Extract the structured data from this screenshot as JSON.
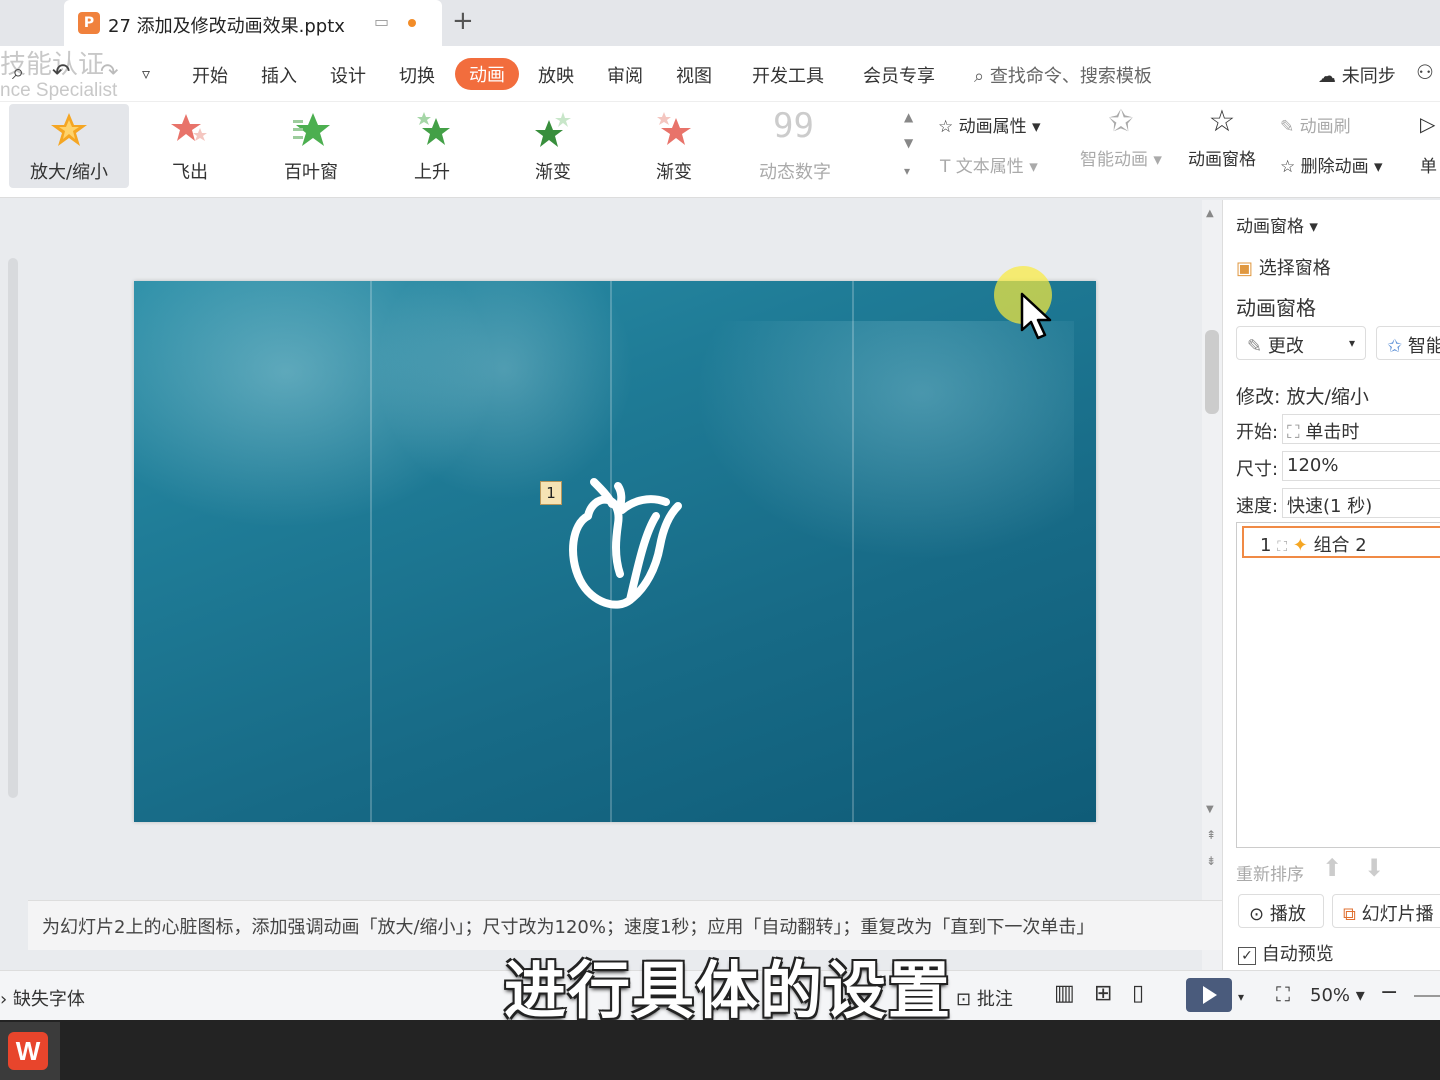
{
  "titlebar": {
    "file_name": "27 添加及修改动画效果.pptx",
    "new_tab_symbol": "+"
  },
  "watermark": {
    "line1": "技能认证",
    "line2": "nce Specialist"
  },
  "menu": {
    "items": [
      "开始",
      "插入",
      "设计",
      "切换",
      "动画",
      "放映",
      "审阅",
      "视图",
      "开发工具",
      "会员专享"
    ],
    "active": "动画",
    "search_placeholder": "查找命令、搜索模板",
    "sync_status": "未同步"
  },
  "ribbon": {
    "effects": [
      {
        "label": "放大/缩小",
        "icon": "zoom-star-icon",
        "selected": true
      },
      {
        "label": "飞出",
        "icon": "fly-out-star-icon"
      },
      {
        "label": "百叶窗",
        "icon": "blinds-star-icon"
      },
      {
        "label": "上升",
        "icon": "rise-star-icon"
      },
      {
        "label": "渐变",
        "icon": "fade-star-icon"
      },
      {
        "label": "渐变",
        "icon": "fade-red-star-icon"
      },
      {
        "label": "动态数字",
        "icon": "dynamic-number-icon",
        "disabled": true
      }
    ],
    "anim_props": "动画属性",
    "text_props": "文本属性",
    "smart_anim": "智能动画",
    "anim_pane": "动画窗格",
    "anim_brush": "动画刷",
    "delete_anim": "删除动画",
    "single": "单"
  },
  "slide": {
    "anim_order_tag": "1",
    "accent": "#1f7c97"
  },
  "notes": {
    "text": "为幻灯片2上的心脏图标，添加强调动画「放大/缩小」；尺寸改为120%；速度1秒；应用「自动翻转」；重复改为「直到下一次单击」"
  },
  "pane": {
    "header": "动画窗格",
    "select_pane": "选择窗格",
    "title": "动画窗格",
    "change_btn": "更改",
    "smart_btn": "智能",
    "modify_label": "修改: 放大/缩小",
    "start_label": "开始:",
    "start_value": "单击时",
    "size_label": "尺寸:",
    "size_value": "120%",
    "speed_label": "速度:",
    "speed_value": "快速(1 秒)",
    "list_item": {
      "index": "1",
      "name": "组合 2"
    },
    "reorder": "重新排序",
    "play_btn": "播放",
    "slideshow_btn": "幻灯片播",
    "auto_preview": "自动预览"
  },
  "status": {
    "missing_font": "缺失字体",
    "comments": "批注",
    "zoom": "50%"
  },
  "subtitle": "进行具体的设置",
  "taskbar": {
    "app_icon": "wps-icon"
  }
}
